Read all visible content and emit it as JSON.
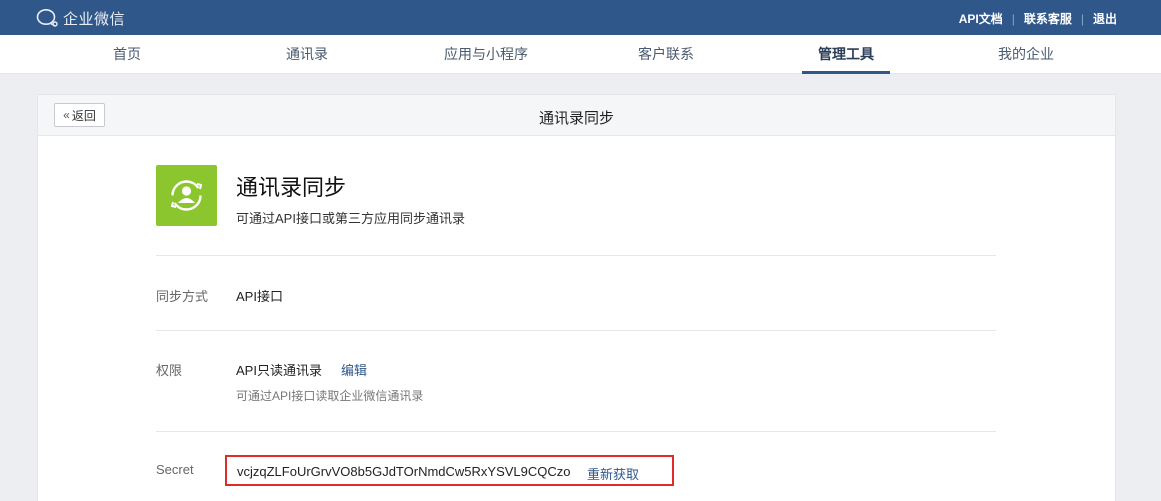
{
  "header": {
    "brand": "企业微信",
    "links": [
      "API文档",
      "联系客服",
      "退出"
    ]
  },
  "nav": {
    "items": [
      "首页",
      "通讯录",
      "应用与小程序",
      "客户联系",
      "管理工具",
      "我的企业"
    ],
    "active": "管理工具"
  },
  "panel": {
    "back_label": "返回",
    "title": "通讯录同步"
  },
  "app": {
    "name": "通讯录同步",
    "description": "可通过API接口或第三方应用同步通讯录",
    "icon": "sync-contacts-icon"
  },
  "settings": {
    "sync_method_label": "同步方式",
    "sync_method_value": "API接口",
    "permission_label": "权限",
    "permission_value": "API只读通讯录",
    "permission_edit": "编辑",
    "permission_hint": "可通过API接口读取企业微信通讯录",
    "secret_label": "Secret",
    "secret_value": "vcjzqZLFoUrGrvVO8b5GJdTOrNmdCw5RxYSVL9CQCzo",
    "secret_refresh": "重新获取"
  },
  "colors": {
    "header_bg": "#2f5789",
    "accent": "#2f5789",
    "app_icon_bg": "#8cc62e",
    "highlight_border": "#e02b2b"
  }
}
